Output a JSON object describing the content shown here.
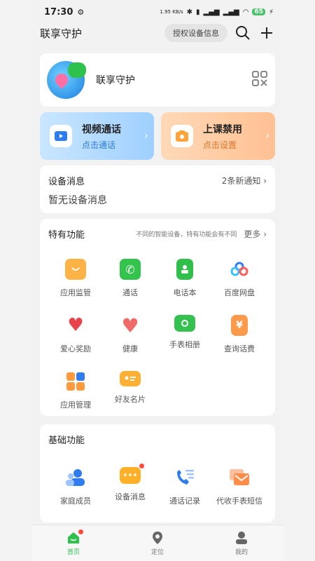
{
  "statusbar": {
    "time": "17:30",
    "net_speed": "1.95 KB/s",
    "battery": "65"
  },
  "header": {
    "title": "联享守护",
    "authorize_label": "授权设备信息"
  },
  "profile": {
    "name": "联享守护"
  },
  "quick": [
    {
      "title": "视频通话",
      "subtitle": "点击通话"
    },
    {
      "title": "上课禁用",
      "subtitle": "点击设置"
    }
  ],
  "device_messages": {
    "title": "设备消息",
    "count": "2条新通知",
    "body": "暂无设备消息"
  },
  "special": {
    "title": "特有功能",
    "hint": "不同的智能设备，特有功能会有不同",
    "more": "更多",
    "items": [
      {
        "label": "应用监管",
        "icon": "bag-icon",
        "color": "#ffb347"
      },
      {
        "label": "通话",
        "icon": "phone-icon",
        "color": "#34c44d"
      },
      {
        "label": "电话本",
        "icon": "contacts-book-icon",
        "color": "#2fbf4a"
      },
      {
        "label": "百度网盘",
        "icon": "cloud-icon",
        "color": "#3b8cff"
      },
      {
        "label": "爱心奖励",
        "icon": "heart-icon",
        "color": "#e8424a"
      },
      {
        "label": "健康",
        "icon": "health-heart-icon",
        "color": "#f06a6a"
      },
      {
        "label": "手表相册",
        "icon": "camera-icon",
        "color": "#35c150"
      },
      {
        "label": "查询话费",
        "icon": "bill-icon",
        "color": "#ff9a4a"
      },
      {
        "label": "应用管理",
        "icon": "app-grid-icon",
        "color": "#ff9b3d"
      },
      {
        "label": "好友名片",
        "icon": "card-icon",
        "color": "#ffb033"
      }
    ]
  },
  "basic": {
    "title": "基础功能",
    "items": [
      {
        "label": "家庭成员",
        "icon": "family-icon",
        "color": "#2f7cf0"
      },
      {
        "label": "设备消息",
        "icon": "message-icon",
        "color": "#ffb029"
      },
      {
        "label": "通话记录",
        "icon": "call-log-icon",
        "color": "#2f7cf0"
      },
      {
        "label": "代收手表短信",
        "icon": "sms-icon",
        "color": "#ff8d4a"
      }
    ]
  },
  "tabs": [
    {
      "label": "首页",
      "icon": "home-icon"
    },
    {
      "label": "定位",
      "icon": "location-icon"
    },
    {
      "label": "我的",
      "icon": "person-icon"
    }
  ],
  "colors": {
    "accent": "#2ec24c",
    "badge": "#ff4a3a"
  }
}
